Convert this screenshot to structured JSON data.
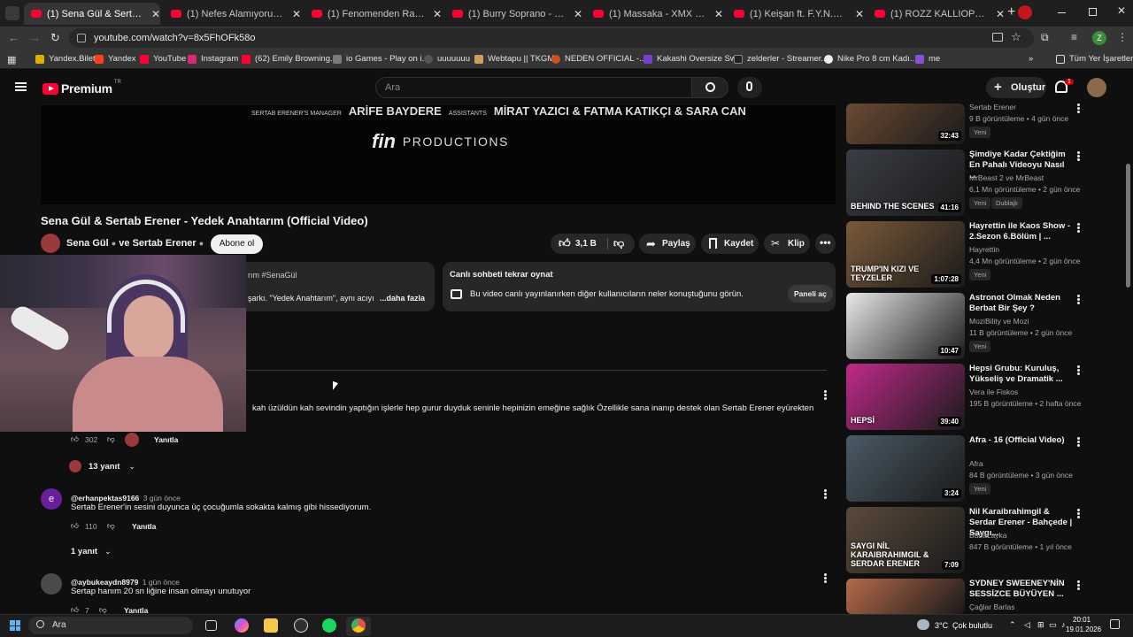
{
  "browser": {
    "tabs": [
      {
        "title": "(1) Sena Gül & Sertab Erener - Y",
        "active": true
      },
      {
        "title": "(1) Nefes Alamıyorum - YouTub"
      },
      {
        "title": "(1) Fenomenden Rapçiye, Rapç"
      },
      {
        "title": "(1) Burry Soprano - Kağıt & Kal"
      },
      {
        "title": "(1) Massaka - XMX (Official vide"
      },
      {
        "title": "(1) Keişan ft. F.Y.N.X - Kurtulam"
      },
      {
        "title": "(1) ROZZ KALLIOPE - DİVA - Yo"
      }
    ],
    "new_tab": "+",
    "url": "youtube.com/watch?v=8x5FhOFk58o",
    "bookmarks": [
      "Yandex.Bilet",
      "Yandex",
      "YouTube",
      "Instagram",
      "(62) Emily Browning...",
      "io Games - Play on i...",
      "uuuuuuu",
      "Webtapu || TKGM",
      "NEDEN OFFICIAL -...",
      "Kakashi Oversize Sw...",
      "zelderler - Streamer...",
      "Nike Pro 8 cm Kadı...",
      "me"
    ],
    "bookmarks_more": "»",
    "all_bookmarks": "Tüm Yer İşaretleri",
    "profile_letter": "Z"
  },
  "youtube": {
    "logo": "Premium",
    "logo_region": "TR",
    "search_placeholder": "Ara",
    "signin": "Oturum",
    "notif_count": "1",
    "signin_label": "Oluştur"
  },
  "video": {
    "credits_left": "SERTAB ERENER'S MANAGER",
    "credits_name": "ARİFE BAYDERE",
    "credits_assist": "ASSISTANTS",
    "credits_names2": "MİRAT YAZICI & FATMA KATIKÇI & SARA CAN",
    "production": "PRODUCTIONS",
    "title": "Sena Gül & Sertab Erener - Yedek Anahtarım (Official Video)",
    "channel": "Sena Gül",
    "channel_join": "ve",
    "channel2": "Sertab Erener",
    "subscribe": "Abone ol",
    "likes": "3,1 B",
    "share": "Paylaş",
    "save": "Kaydet",
    "clip": "Klip",
    "desc_tag": "rım #SenaGül",
    "desc_text": "şarkı. \"Yedek Anahtarım\", aynı acıyı",
    "desc_more": "...daha fazla",
    "chat_title": "Canlı sohbeti tekrar oynat",
    "chat_desc": "Bu video canlı yayınlanırken diğer kullanıcıların neler konuştuğunu görün.",
    "chat_btn": "Paneli aç"
  },
  "comments": [
    {
      "text": "kah üzüldün kah sevindin yaptığın işlerle hep gurur duyduk seninle hepinizin emeğine sağlık Özellikle sana inanıp destek olan Sertab Erener eyürekten",
      "likes": "302",
      "reply": "Yanıtla",
      "replies": "13 yanıt"
    },
    {
      "author": "@erhanpektas9166",
      "time": "3 gün önce",
      "text": "Sertab Erener'in sesini duyunca üç çocuğumla sokakta kalmış gibi hissediyorum.",
      "likes": "110",
      "reply": "Yanıtla",
      "replies": "1 yanıt",
      "avatar": "e"
    },
    {
      "author": "@aybukeaydn8979",
      "time": "1 gün önce",
      "text": "Sertap hanım 20 sn liğine insan olmayı unutuyor",
      "likes": "7",
      "reply": "Yanıtla"
    }
  ],
  "sidebar": [
    {
      "title": "",
      "channel": "Sertab Erener",
      "views": "9 B görüntüleme • 4 gün önce",
      "badge": "Yeni",
      "duration": "32:43",
      "color": "#6b4a33"
    },
    {
      "title": "Şimdiye Kadar Çektiğim En Pahalı Videoyu Nasıl ...",
      "channel": "MrBeast 2 ve MrBeast",
      "views": "6,1 Mn görüntüleme • 2 gün önce",
      "badge": "Yeni",
      "badge2": "Dublajlı",
      "duration": "41:16",
      "color": "#3a3d44",
      "thumb_text": "BEHIND THE SCENES"
    },
    {
      "title": "Hayrettin ile Kaos Show - 2.Sezon 6.Bölüm | ...",
      "channel": "Hayrettin",
      "views": "4,4 Mn görüntüleme • 2 gün önce",
      "badge": "Yeni",
      "duration": "1:07:28",
      "color": "#7a5a3a",
      "thumb_text": "TRUMP'IN KIZI VE TEYZELER"
    },
    {
      "title": "Astronot Olmak Neden Berbat Bir Şey ?",
      "channel": "MoziBility ve Mozi",
      "views": "11 B görüntüleme • 2 gün önce",
      "badge": "Yeni",
      "duration": "10:47",
      "color": "#e8e8e8"
    },
    {
      "title": "Hepsi Grubu: Kuruluş, Yükseliş ve Dramatik ...",
      "channel": "Vera ile Fiskos",
      "views": "195 B görüntüleme • 2 hafta önce",
      "duration": "39:40",
      "color": "#c02a8a",
      "thumb_text": "HEPSİ"
    },
    {
      "title": "Afra - 16 (Official Video)",
      "channel": "Afra",
      "views": "84 B görüntüleme • 3 gün önce",
      "badge": "Yeni",
      "duration": "3:24",
      "color": "#4a5a66"
    },
    {
      "title": "Nil Karaibrahimgil & Serdar Erener - Bahçede | Saygı...",
      "channel": "BabaLayka",
      "views": "847 B görüntüleme • 1 yıl önce",
      "duration": "7:09",
      "color": "#5a4a3a",
      "thumb_text": "SAYGI NİL KARAIBRAHIMGIL & SERDAR ERENER"
    },
    {
      "title": "SYDNEY SWEENEY'NİN SESSİZCE BÜYÜYEN ...",
      "channel": "Çağlar Barlas",
      "views": "",
      "duration": "",
      "color": "#b56a4a"
    }
  ],
  "taskbar": {
    "search": "Ara",
    "weather": "3°C",
    "weather_desc": "Çok bulutlu",
    "time": "20:01",
    "date": "19.01.2026"
  },
  "colors": {
    "youtube_red": "#ff0033",
    "bg": "#0f0f0f",
    "chip": "#272727"
  }
}
